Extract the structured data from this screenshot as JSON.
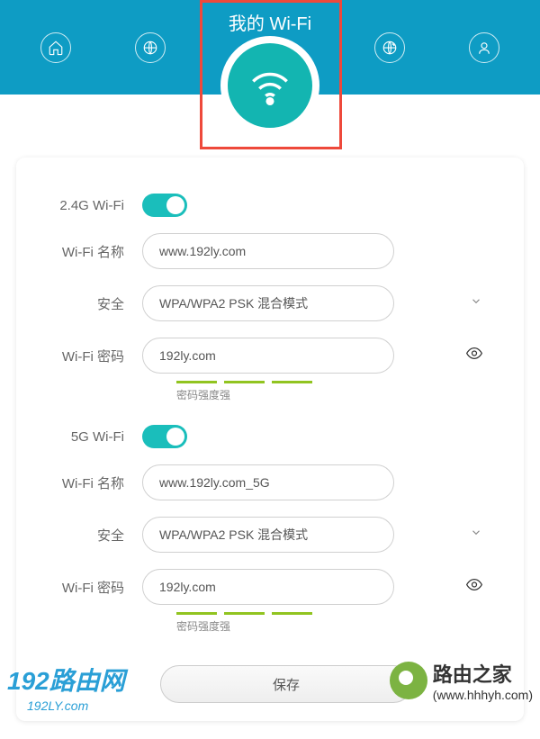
{
  "header": {
    "title": "我的 Wi-Fi",
    "nav_icons": [
      "home",
      "internet",
      "wifi-center",
      "speed",
      "user"
    ]
  },
  "wifi_24g": {
    "band_label": "2.4G Wi-Fi",
    "enabled": true,
    "name_label": "Wi-Fi 名称",
    "name_value": "www.192ly.com",
    "security_label": "安全",
    "security_value": "WPA/WPA2 PSK 混合模式",
    "password_label": "Wi-Fi 密码",
    "password_value": "192ly.com",
    "strength_text": "密码强度强"
  },
  "wifi_5g": {
    "band_label": "5G Wi-Fi",
    "enabled": true,
    "name_label": "Wi-Fi 名称",
    "name_value": "www.192ly.com_5G",
    "security_label": "安全",
    "security_value": "WPA/WPA2 PSK 混合模式",
    "password_label": "Wi-Fi 密码",
    "password_value": "192ly.com",
    "strength_text": "密码强度强"
  },
  "save_button": "保存",
  "watermarks": {
    "left_main": "192路由网",
    "left_sub": "192LY.com",
    "right_main": "路由之家",
    "right_sub": "(www.hhhyh.com)"
  },
  "colors": {
    "header_bg": "#0e9cc4",
    "accent": "#13b5b1",
    "highlight": "#ee493b",
    "strength": "#91c420"
  }
}
